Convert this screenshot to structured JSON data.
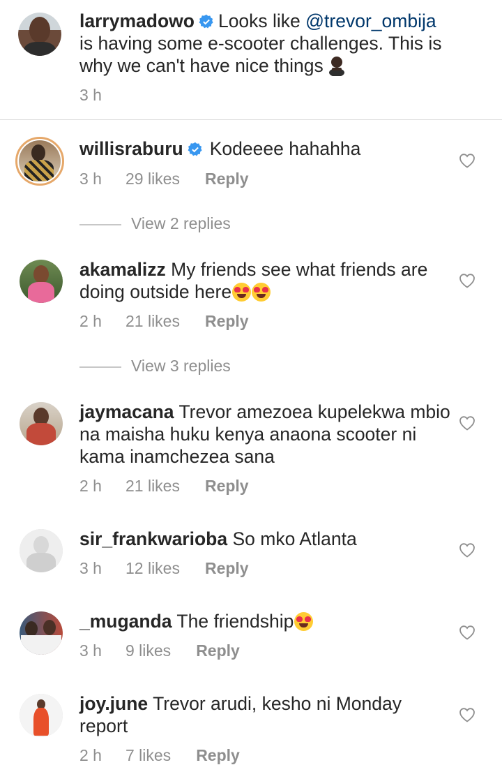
{
  "caption": {
    "username": "larrymadowo",
    "text_before": "Looks like ",
    "mention": "@trevor_ombija",
    "text_after": " is having some e-scooter challenges. This is why we can't have nice things",
    "time": "3 h"
  },
  "comments": [
    {
      "username": "willisraburu",
      "verified": true,
      "text": "Kodeeee hahahha",
      "time": "3 h",
      "likes": "29 likes",
      "reply": "Reply",
      "view_replies": "View 2 replies"
    },
    {
      "username": "akamalizz",
      "text": "My friends see what friends are doing outside here",
      "time": "2 h",
      "likes": "21 likes",
      "reply": "Reply",
      "view_replies": "View 3 replies"
    },
    {
      "username": "jaymacana",
      "text": "Trevor amezoea kupelekwa mbio na maisha huku kenya anaona scooter ni kama inamchezea sana",
      "time": "2 h",
      "likes": "21 likes",
      "reply": "Reply"
    },
    {
      "username": "sir_frankwarioba",
      "text": "So mko Atlanta",
      "time": "3 h",
      "likes": "12 likes",
      "reply": "Reply"
    },
    {
      "username": "_muganda",
      "text": "The friendship",
      "time": "3 h",
      "likes": "9 likes",
      "reply": "Reply"
    },
    {
      "username": "joy.june",
      "text": "Trevor arudi, kesho ni Monday report",
      "time": "2 h",
      "likes": "7 likes",
      "reply": "Reply"
    }
  ],
  "colors": {
    "verified": "#3897f0",
    "meta": "#8e8e8e",
    "mention": "#00376b"
  }
}
